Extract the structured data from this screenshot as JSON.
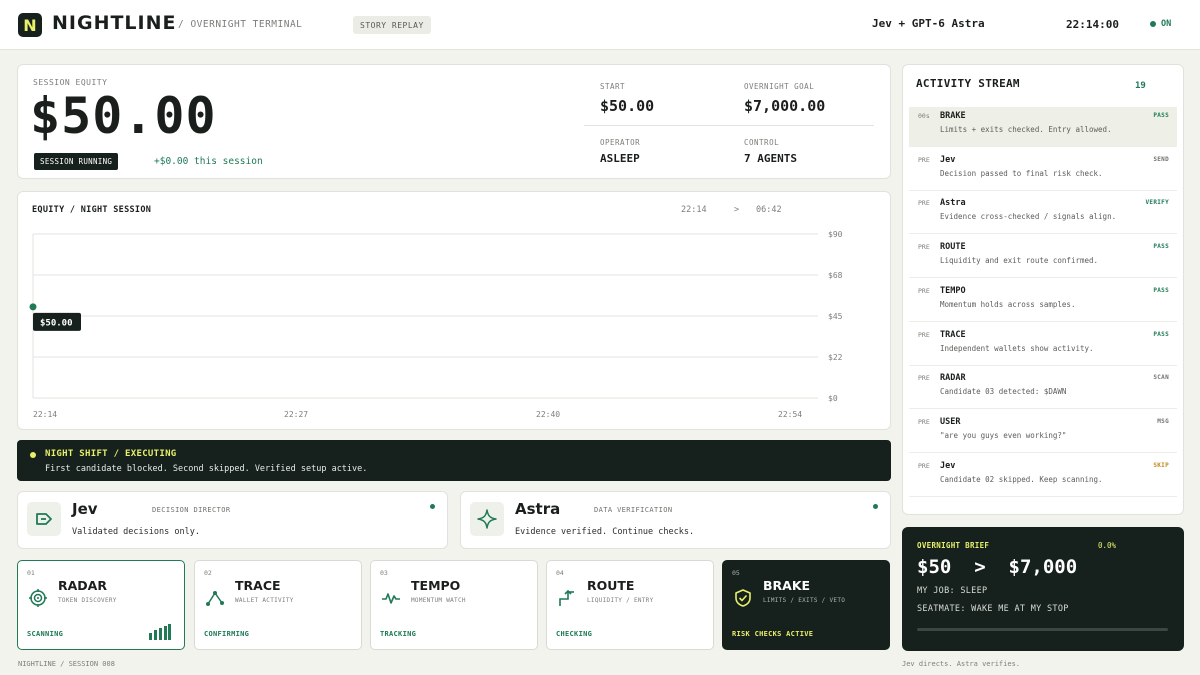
{
  "header": {
    "brand": "NIGHTLINE",
    "logo_letter": "N",
    "subtitle": "/ OVERNIGHT TERMINAL",
    "story_replay": "STORY REPLAY",
    "pair": "Jev + GPT-6 Astra",
    "clock": "22:14:00",
    "status": "ON"
  },
  "equity": {
    "label": "SESSION EQUITY",
    "value": "$50.00",
    "badge": "SESSION RUNNING",
    "delta": "+$0.00 this session",
    "start_label": "START",
    "start_value": "$50.00",
    "goal_label": "OVERNIGHT GOAL",
    "goal_value": "$7,000.00",
    "operator_label": "OPERATOR",
    "operator_value": "ASLEEP",
    "control_label": "CONTROL",
    "control_value": "7 AGENTS"
  },
  "chart_data": {
    "type": "line",
    "title": "EQUITY / NIGHT SESSION",
    "range_start": "22:14",
    "range_sep": ">",
    "range_end": "06:42",
    "x_ticks": [
      "22:14",
      "22:27",
      "22:40",
      "22:54"
    ],
    "y_ticks": [
      "$90",
      "$68",
      "$45",
      "$22",
      "$0"
    ],
    "ylim": [
      0,
      90
    ],
    "points": [
      {
        "x": "22:14",
        "y": 50.0
      }
    ],
    "current_label": "$50.00",
    "colors": {
      "line": "#1f7a55",
      "grid": "#e3e4dd"
    }
  },
  "banner": {
    "title": "NIGHT SHIFT / EXECUTING",
    "text": "First candidate blocked. Second skipped. Verified setup active."
  },
  "agents": [
    {
      "name": "Jev",
      "role": "DECISION DIRECTOR",
      "desc": "Validated decisions only.",
      "icon": "arrow-tag-icon"
    },
    {
      "name": "Astra",
      "role": "DATA VERIFICATION",
      "desc": "Evidence verified. Continue checks.",
      "icon": "sparkle-icon"
    }
  ],
  "modules": [
    {
      "num": "01",
      "name": "RADAR",
      "sub": "TOKEN DISCOVERY",
      "status": "SCANNING",
      "icon": "radar-icon"
    },
    {
      "num": "02",
      "name": "TRACE",
      "sub": "WALLET ACTIVITY",
      "status": "CONFIRMING",
      "icon": "trace-icon"
    },
    {
      "num": "03",
      "name": "TEMPO",
      "sub": "MOMENTUM WATCH",
      "status": "TRACKING",
      "icon": "pulse-icon"
    },
    {
      "num": "04",
      "name": "ROUTE",
      "sub": "LIQUIDITY / ENTRY",
      "status": "CHECKING",
      "icon": "route-icon"
    },
    {
      "num": "05",
      "name": "BRAKE",
      "sub": "LIMITS / EXITS / VETO",
      "status": "RISK CHECKS ACTIVE",
      "icon": "shield-check-icon"
    }
  ],
  "stream": {
    "title": "ACTIVITY STREAM",
    "count": "19",
    "events": [
      {
        "time": "00s",
        "name": "BRAKE",
        "desc": "Limits + exits checked. Entry allowed.",
        "tag": "PASS"
      },
      {
        "time": "PRE",
        "name": "Jev",
        "desc": "Decision passed to final risk check.",
        "tag": "SEND"
      },
      {
        "time": "PRE",
        "name": "Astra",
        "desc": "Evidence cross-checked / signals align.",
        "tag": "VERIFY"
      },
      {
        "time": "PRE",
        "name": "ROUTE",
        "desc": "Liquidity and exit route confirmed.",
        "tag": "PASS"
      },
      {
        "time": "PRE",
        "name": "TEMPO",
        "desc": "Momentum holds across samples.",
        "tag": "PASS"
      },
      {
        "time": "PRE",
        "name": "TRACE",
        "desc": "Independent wallets show activity.",
        "tag": "PASS"
      },
      {
        "time": "PRE",
        "name": "RADAR",
        "desc": "Candidate 03 detected: $DAWN",
        "tag": "SCAN"
      },
      {
        "time": "PRE",
        "name": "USER",
        "desc": "\"are you guys even working?\"",
        "tag": "MSG"
      },
      {
        "time": "PRE",
        "name": "Jev",
        "desc": "Candidate 02 skipped. Keep scanning.",
        "tag": "SKIP"
      }
    ],
    "tag_colors": {
      "PASS": "#1f7a55",
      "VERIFY": "#1f7a55",
      "SEND": "#6f736c",
      "SCAN": "#6f736c",
      "MSG": "#6f736c",
      "SKIP": "#c28a1a"
    }
  },
  "brief": {
    "label": "OVERNIGHT BRIEF",
    "pct": "0.0%",
    "big": "$50  >  $7,000",
    "job": "MY JOB: SLEEP",
    "seatmate": "SEATMATE: WAKE ME AT MY STOP",
    "progress": 0.0
  },
  "footer": {
    "left": "NIGHTLINE / SESSION 008",
    "right": "Jev directs. Astra verifies."
  }
}
